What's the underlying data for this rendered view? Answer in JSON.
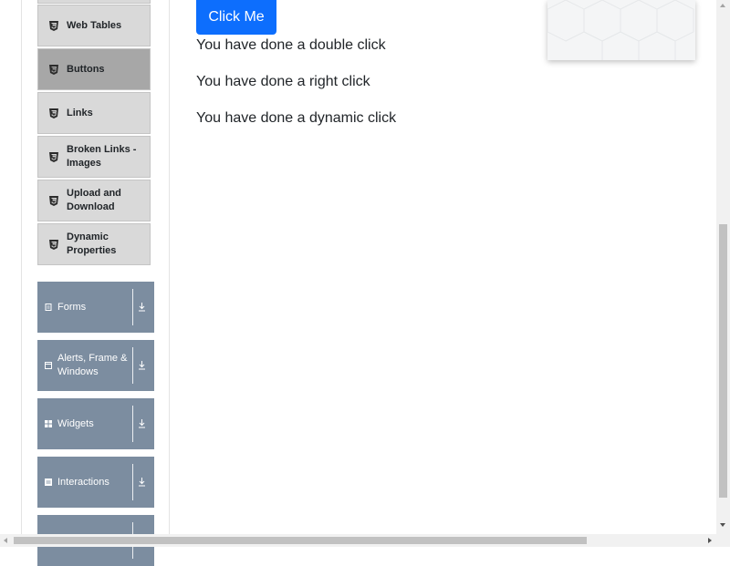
{
  "sidebar": {
    "sub_items": [
      {
        "label": "Web Tables",
        "active": false
      },
      {
        "label": "Buttons",
        "active": true
      },
      {
        "label": "Links",
        "active": false
      },
      {
        "label": "Broken Links - Images",
        "active": false
      },
      {
        "label": "Upload and Download",
        "active": false
      },
      {
        "label": "Dynamic Properties",
        "active": false
      }
    ],
    "groups": [
      {
        "label": "Forms",
        "icon": "document-icon"
      },
      {
        "label": "Alerts, Frame & Windows",
        "icon": "window-icon"
      },
      {
        "label": "Widgets",
        "icon": "grid-icon"
      },
      {
        "label": "Interactions",
        "icon": "list-icon"
      },
      {
        "label": "",
        "icon": "book-icon"
      }
    ]
  },
  "main": {
    "click_button_label": "Click Me",
    "messages": [
      "You have done a double click",
      "You have done a right click",
      "You have done a dynamic click"
    ]
  },
  "colors": {
    "primary": "#0d6efd",
    "group_bg": "#7c8da0",
    "sub_item_bg": "#d9d9d9",
    "sub_item_active_bg": "#a7a7a7"
  }
}
